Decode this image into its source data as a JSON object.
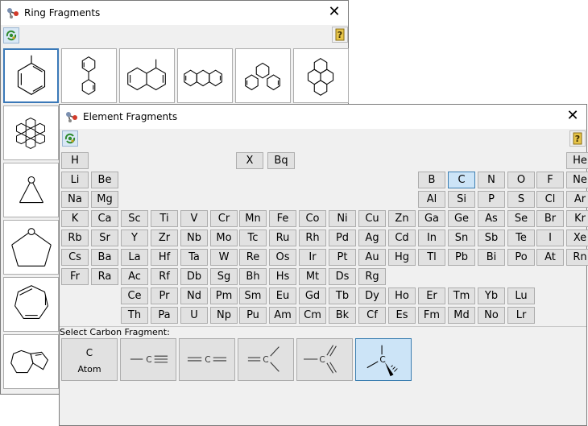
{
  "ring_window": {
    "title": "Ring Fragments",
    "close_glyph": "✕",
    "icons": {
      "title": "molecule-icon",
      "refresh": "refresh-molecule-icon",
      "help": "question-help-icon"
    }
  },
  "element_window": {
    "title": "Element Fragments",
    "close_glyph": "✕",
    "selected_element": "C",
    "carbon_label": "Select Carbon Fragment:",
    "atom_button": {
      "symbol": "C",
      "label": "Atom"
    },
    "carbon_fragments": [
      "atom",
      "triple-bond",
      "allene",
      "double-bond",
      "trigonal",
      "tetrahedral"
    ],
    "selected_carbon_fragment": "tetrahedral",
    "rows": [
      [
        "H",
        "",
        "",
        "",
        "",
        "",
        "",
        "",
        "",
        "",
        "",
        "",
        "",
        "",
        "",
        "",
        "",
        "He"
      ],
      [
        "Li",
        "Be",
        "",
        "",
        "",
        "",
        "",
        "",
        "",
        "",
        "",
        "",
        "B",
        "C",
        "N",
        "O",
        "F",
        "Ne"
      ],
      [
        "Na",
        "Mg",
        "",
        "",
        "",
        "",
        "",
        "",
        "",
        "",
        "",
        "",
        "Al",
        "Si",
        "P",
        "S",
        "Cl",
        "Ar"
      ],
      [
        "K",
        "Ca",
        "Sc",
        "Ti",
        "V",
        "Cr",
        "Mn",
        "Fe",
        "Co",
        "Ni",
        "Cu",
        "Zn",
        "Ga",
        "Ge",
        "As",
        "Se",
        "Br",
        "Kr"
      ],
      [
        "Rb",
        "Sr",
        "Y",
        "Zr",
        "Nb",
        "Mo",
        "Tc",
        "Ru",
        "Rh",
        "Pd",
        "Ag",
        "Cd",
        "In",
        "Sn",
        "Sb",
        "Te",
        "I",
        "Xe"
      ],
      [
        "Cs",
        "Ba",
        "La",
        "Hf",
        "Ta",
        "W",
        "Re",
        "Os",
        "Ir",
        "Pt",
        "Au",
        "Hg",
        "Tl",
        "Pb",
        "Bi",
        "Po",
        "At",
        "Rn"
      ],
      [
        "Fr",
        "Ra",
        "Ac",
        "Rf",
        "Db",
        "Sg",
        "Bh",
        "Hs",
        "Mt",
        "Ds",
        "Rg",
        "",
        "",
        "",
        "",
        "",
        "",
        ""
      ],
      [
        "",
        "",
        "Ce",
        "Pr",
        "Nd",
        "Pm",
        "Sm",
        "Eu",
        "Gd",
        "Tb",
        "Dy",
        "Ho",
        "Er",
        "Tm",
        "Yb",
        "Lu",
        "",
        ""
      ],
      [
        "",
        "",
        "Th",
        "Pa",
        "U",
        "Np",
        "Pu",
        "Am",
        "Cm",
        "Bk",
        "Cf",
        "Es",
        "Fm",
        "Md",
        "No",
        "Lr",
        "",
        ""
      ]
    ],
    "extra": [
      "X",
      "Bq"
    ]
  }
}
